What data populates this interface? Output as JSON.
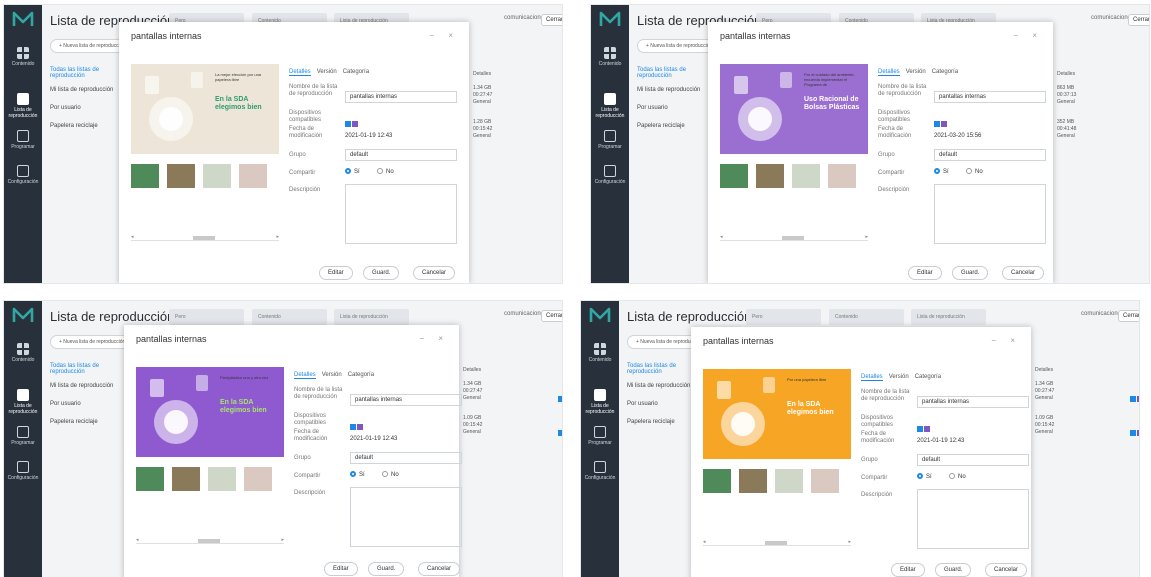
{
  "app": {
    "title": "Lista de reproducción",
    "nav": [
      {
        "label": "Contenido",
        "icon": "grid-icon"
      },
      {
        "label": "Lista de reproducción",
        "icon": "playlist-icon"
      },
      {
        "label": "Programar",
        "icon": "calendar-icon"
      },
      {
        "label": "Configuración",
        "icon": "settings-icon"
      }
    ],
    "top_tabs": [
      "Pero",
      "Contenido",
      "Lista de reproducción"
    ],
    "account": "comunicaciones",
    "close_label": "Cerrar",
    "help_label": "?",
    "new_list": "+ Nueva lista de reproducción",
    "left_lists": [
      "Todas las listas de reproducción",
      "Mi lista de reproducción",
      "Por usuario",
      "Papelera reciclaje"
    ],
    "right_header": {
      "filter": "reproducción ∨",
      "search": "Nombre de la lista de reproducción",
      "col_details": "Detalles",
      "col_devices": "Dispositivo"
    }
  },
  "dialog": {
    "title": "pantallas internas",
    "tabs": [
      "Detalles",
      "Versión",
      "Categoría"
    ],
    "field_labels": {
      "name": "Nombre de la lista de reproducción",
      "devices": "Dispositivos compatibles",
      "modified": "Fecha de modificación",
      "group": "Grupo",
      "share": "Compartir",
      "description": "Descripción"
    },
    "radio_yes": "Sí",
    "radio_no": "No",
    "buttons": [
      "Editar",
      "Guard.",
      "Cancelar"
    ]
  },
  "panels": [
    {
      "name_value": "pantallas internas",
      "modified": "2021-01-19 12:43",
      "group": "default",
      "rows": [
        [
          "1.34 GB",
          "00:27:47",
          "General"
        ],
        [
          "1.28 GB",
          "00:15:42",
          "General"
        ]
      ],
      "preview": {
        "headline": "En la SDA elegimos bien",
        "sub": "La mejor elección por una papelera libre",
        "bg": "#ede6d8",
        "accent": "#2e9c6b"
      }
    },
    {
      "name_value": "pantallas internas",
      "modified": "2021-03-20 15:56",
      "group": "default",
      "rows": [
        [
          "863 MB",
          "00:37:13",
          "General"
        ],
        [
          "352 MB",
          "00:41:48",
          "General"
        ]
      ],
      "preview": {
        "headline": "Uso Racional de Bolsas Plásticas",
        "sub": "Por el cuidado del ambiente, recuerda implementar el Programa de",
        "bg": "#9b6fd1",
        "accent": "#ffffff"
      }
    },
    {
      "name_value": "pantallas internas",
      "modified": "2021-01-19 12:43",
      "group": "default",
      "rows": [
        [
          "1.34 GB",
          "00:27:47",
          "General"
        ],
        [
          "1.09 GB",
          "00:15:42",
          "General"
        ]
      ],
      "preview": {
        "headline": "En la SDA elegimos bien",
        "sub": "Flexiplástico uno y otro vez",
        "bg": "#8f5ad0",
        "accent": "#a6e36b"
      }
    },
    {
      "name_value": "pantallas internas",
      "modified": "2021-01-19 12:43",
      "group": "default",
      "rows": [
        [
          "1.34 GB",
          "00:27:47",
          "General"
        ],
        [
          "1.09 GB",
          "00:15:42",
          "General"
        ]
      ],
      "preview": {
        "headline": "En la SDA elegimos bien",
        "sub": "Por una papelera libre",
        "bg": "#f7a524",
        "accent": "#ffffff"
      }
    }
  ],
  "colors": {
    "sidebar": "#28303b",
    "accent": "#1e88e5",
    "logo": "#2fa8a3"
  }
}
